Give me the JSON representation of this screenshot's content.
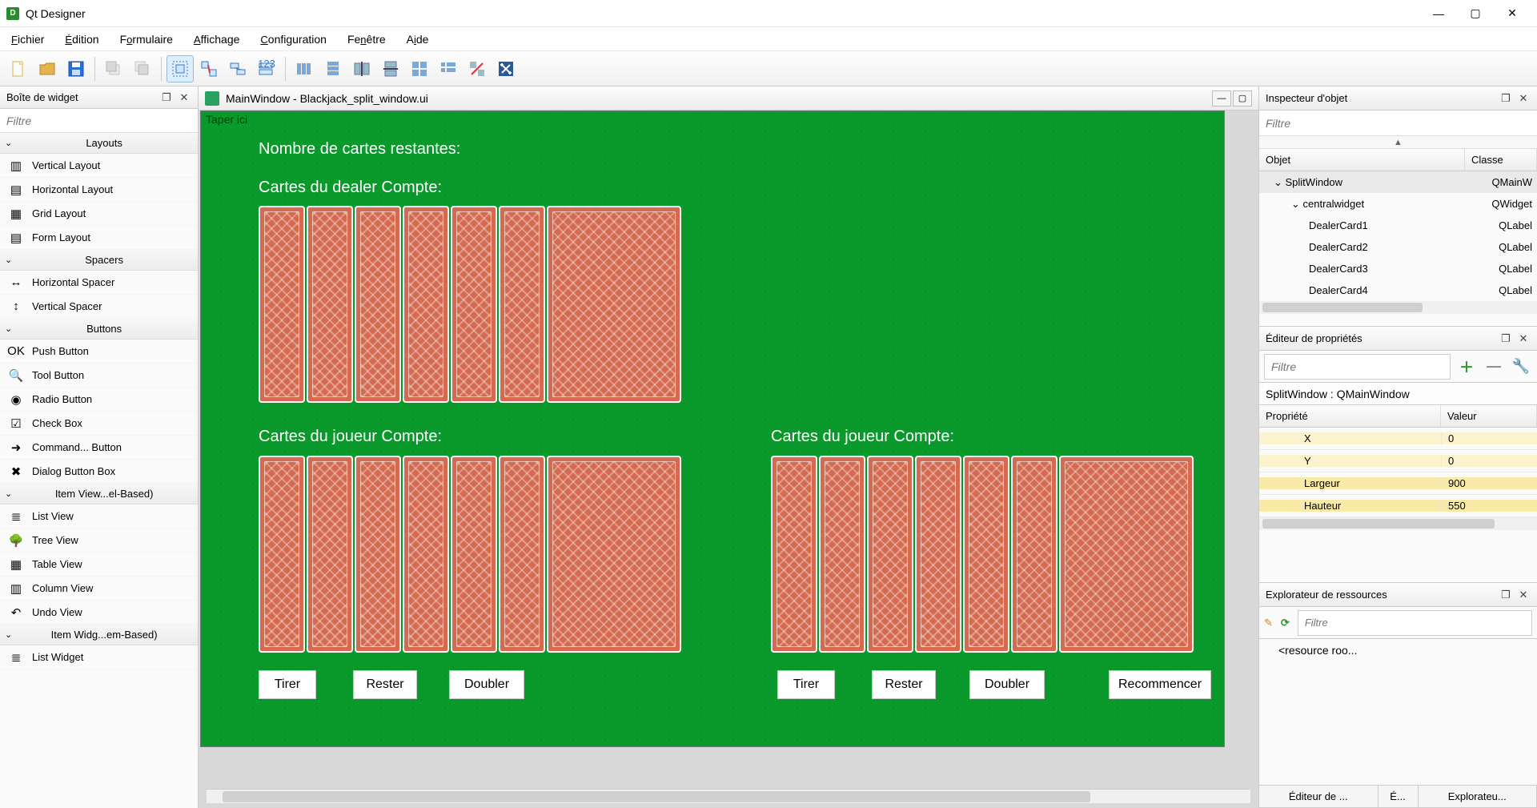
{
  "app": {
    "title": "Qt Designer"
  },
  "menus": [
    "Fichier",
    "Édition",
    "Formulaire",
    "Affichage",
    "Configuration",
    "Fenêtre",
    "Aide"
  ],
  "widgetbox": {
    "title": "Boîte de widget",
    "filter": "Filtre",
    "cats": [
      {
        "name": "Layouts",
        "items": [
          "Vertical Layout",
          "Horizontal Layout",
          "Grid Layout",
          "Form Layout"
        ]
      },
      {
        "name": "Spacers",
        "items": [
          "Horizontal Spacer",
          "Vertical Spacer"
        ]
      },
      {
        "name": "Buttons",
        "items": [
          "Push Button",
          "Tool Button",
          "Radio Button",
          "Check Box",
          "Command... Button",
          "Dialog Button Box"
        ]
      },
      {
        "name": "Item View...el-Based)",
        "items": [
          "List View",
          "Tree View",
          "Table View",
          "Column View",
          "Undo View"
        ]
      },
      {
        "name": "Item Widg...em-Based)",
        "items": [
          "List Widget"
        ]
      }
    ]
  },
  "doc": {
    "title": "MainWindow - Blackjack_split_window.ui",
    "menuhint": "Taper ici",
    "remaining": "Nombre de cartes restantes:",
    "dealer": "Cartes du dealer   Compte:",
    "player1": "Cartes du joueur   Compte:",
    "player2": "Cartes du joueur   Compte:",
    "btns": {
      "tirer": "Tirer",
      "rester": "Rester",
      "doubler": "Doubler",
      "recom": "Recommencer"
    }
  },
  "inspector": {
    "title": "Inspecteur d'objet",
    "filter": "Filtre",
    "cols": {
      "obj": "Objet",
      "cls": "Classe"
    },
    "rows": [
      {
        "name": "SplitWindow",
        "cls": "QMainW",
        "depth": 0,
        "exp": true,
        "sel": true
      },
      {
        "name": "centralwidget",
        "cls": "QWidget",
        "depth": 1,
        "exp": true
      },
      {
        "name": "DealerCard1",
        "cls": "QLabel",
        "depth": 2
      },
      {
        "name": "DealerCard2",
        "cls": "QLabel",
        "depth": 2
      },
      {
        "name": "DealerCard3",
        "cls": "QLabel",
        "depth": 2
      },
      {
        "name": "DealerCard4",
        "cls": "QLabel",
        "depth": 2
      }
    ]
  },
  "props": {
    "title": "Éditeur de propriétés",
    "filter": "Filtre",
    "obj": "SplitWindow : QMainWindow",
    "cols": {
      "p": "Propriété",
      "v": "Valeur"
    },
    "rows": [
      {
        "p": "X",
        "v": "0"
      },
      {
        "p": "Y",
        "v": "0"
      },
      {
        "p": "Largeur",
        "v": "900",
        "b": true
      },
      {
        "p": "Hauteur",
        "v": "550",
        "b": true
      }
    ]
  },
  "res": {
    "title": "Explorateur de ressources",
    "filter": "Filtre",
    "root": "<resource roo..."
  },
  "tabs": [
    "Éditeur de ...",
    "É...",
    "Explorateu..."
  ]
}
